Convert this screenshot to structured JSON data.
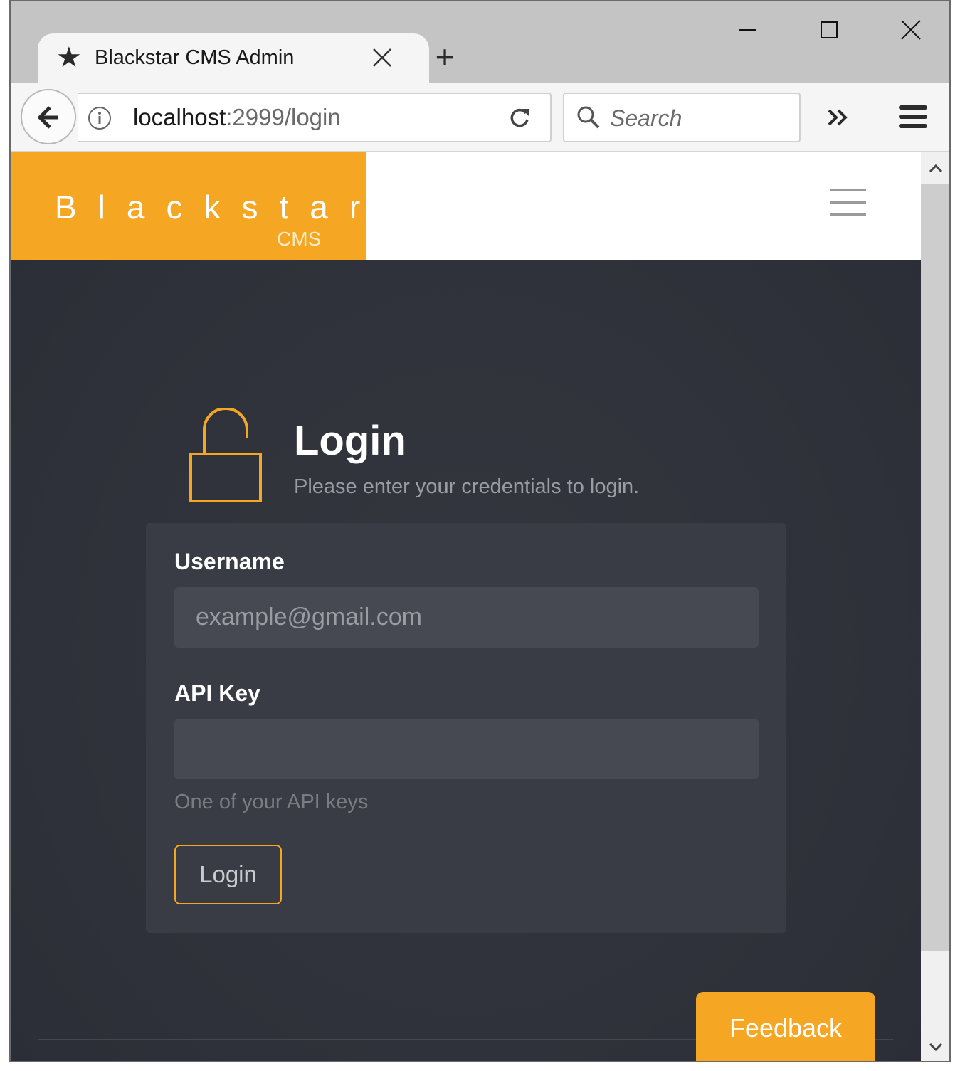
{
  "browser": {
    "tab_title": "Blackstar CMS Admin",
    "url_host": "localhost",
    "url_rest": ":2999/login",
    "search_placeholder": "Search"
  },
  "site": {
    "brand_name": "Blackstar",
    "brand_sub": "CMS",
    "brand_color": "#f5a623"
  },
  "login": {
    "title": "Login",
    "subtitle": "Please enter your credentials to login.",
    "username_label": "Username",
    "username_placeholder": "example@gmail.com",
    "apikey_label": "API Key",
    "apikey_value": "",
    "apikey_hint": "One of your API keys",
    "submit_label": "Login"
  },
  "feedback_label": "Feedback"
}
